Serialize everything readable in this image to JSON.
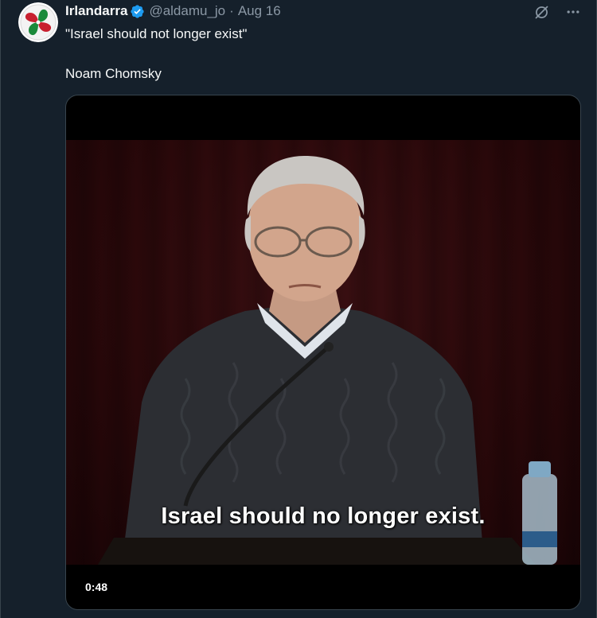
{
  "author": {
    "display_name": "Irlandarra",
    "handle": "@aldamu_jo",
    "separator": "·",
    "date": "Aug 16",
    "avatar_icon": "lauburu-icon",
    "verified_color": "#1d9bf0"
  },
  "tweet": {
    "line1": "\"Israel should not longer exist\"",
    "line2": "Noam Chomsky"
  },
  "media": {
    "caption": "Israel should no longer exist.",
    "duration": "0:48"
  },
  "colors": {
    "background": "#15202b",
    "text": "#f7f9f9",
    "muted": "#8b98a5",
    "accent": "#1d9bf0"
  }
}
